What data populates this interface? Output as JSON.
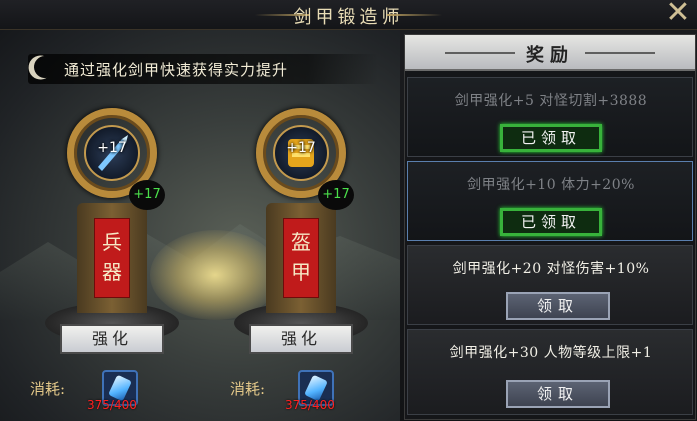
{
  "window": {
    "title": "剑甲锻造师",
    "close_icon": "close-x-icon"
  },
  "intro": {
    "subtitle": "通过强化剑甲快速获得实力提升",
    "icon": "crescent-moon-icon"
  },
  "equipment": [
    {
      "name": "兵器",
      "orb_level": "+17",
      "badge_level": "+17",
      "item_icon": "sword-icon",
      "button_label": "强化",
      "cost_label": "消耗:",
      "cost_value": "375/400",
      "cost_icon": "blue-gem-icon"
    },
    {
      "name": "盔甲",
      "orb_level": "+17",
      "badge_level": "+17",
      "item_icon": "armor-icon",
      "button_label": "强化",
      "cost_label": "消耗:",
      "cost_value": "375/400",
      "cost_icon": "blue-gem-icon"
    }
  ],
  "rewards": {
    "title": "奖励",
    "items": [
      {
        "text": "剑甲强化+5 对怪切割+3888",
        "button": "已领取",
        "state": "claimed"
      },
      {
        "text": "剑甲强化+10 体力+20%",
        "button": "已领取",
        "state": "claimed"
      },
      {
        "text": "剑甲强化+20 对怪伤害+10%",
        "button": "领取",
        "state": "available"
      },
      {
        "text": "剑甲强化+30 人物等级上限+1",
        "button": "领取",
        "state": "available"
      }
    ]
  },
  "colors": {
    "accent_gold": "#e9ddb6",
    "claimed_green": "#38b23b",
    "cost_red": "#ff2020",
    "banner_red": "#c01b1b",
    "level_green": "#4be04b"
  }
}
